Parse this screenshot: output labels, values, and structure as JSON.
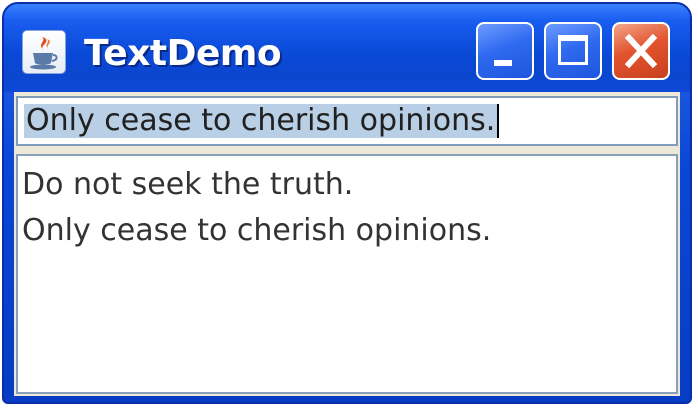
{
  "window": {
    "title": "TextDemo",
    "app_icon": "java-coffee-cup-icon",
    "buttons": {
      "minimize_icon": "minimize-icon",
      "maximize_icon": "maximize-icon",
      "close_icon": "close-icon"
    }
  },
  "text_field": {
    "value": "Only cease to cherish opinions."
  },
  "text_area": {
    "lines": [
      "Do not seek the truth.",
      "Only cease to cherish opinions."
    ]
  },
  "colors": {
    "titlebar": "#0a4ad8",
    "close_button": "#e2542e",
    "selection": "#b8cfe5",
    "field_border": "#7f9db9"
  }
}
